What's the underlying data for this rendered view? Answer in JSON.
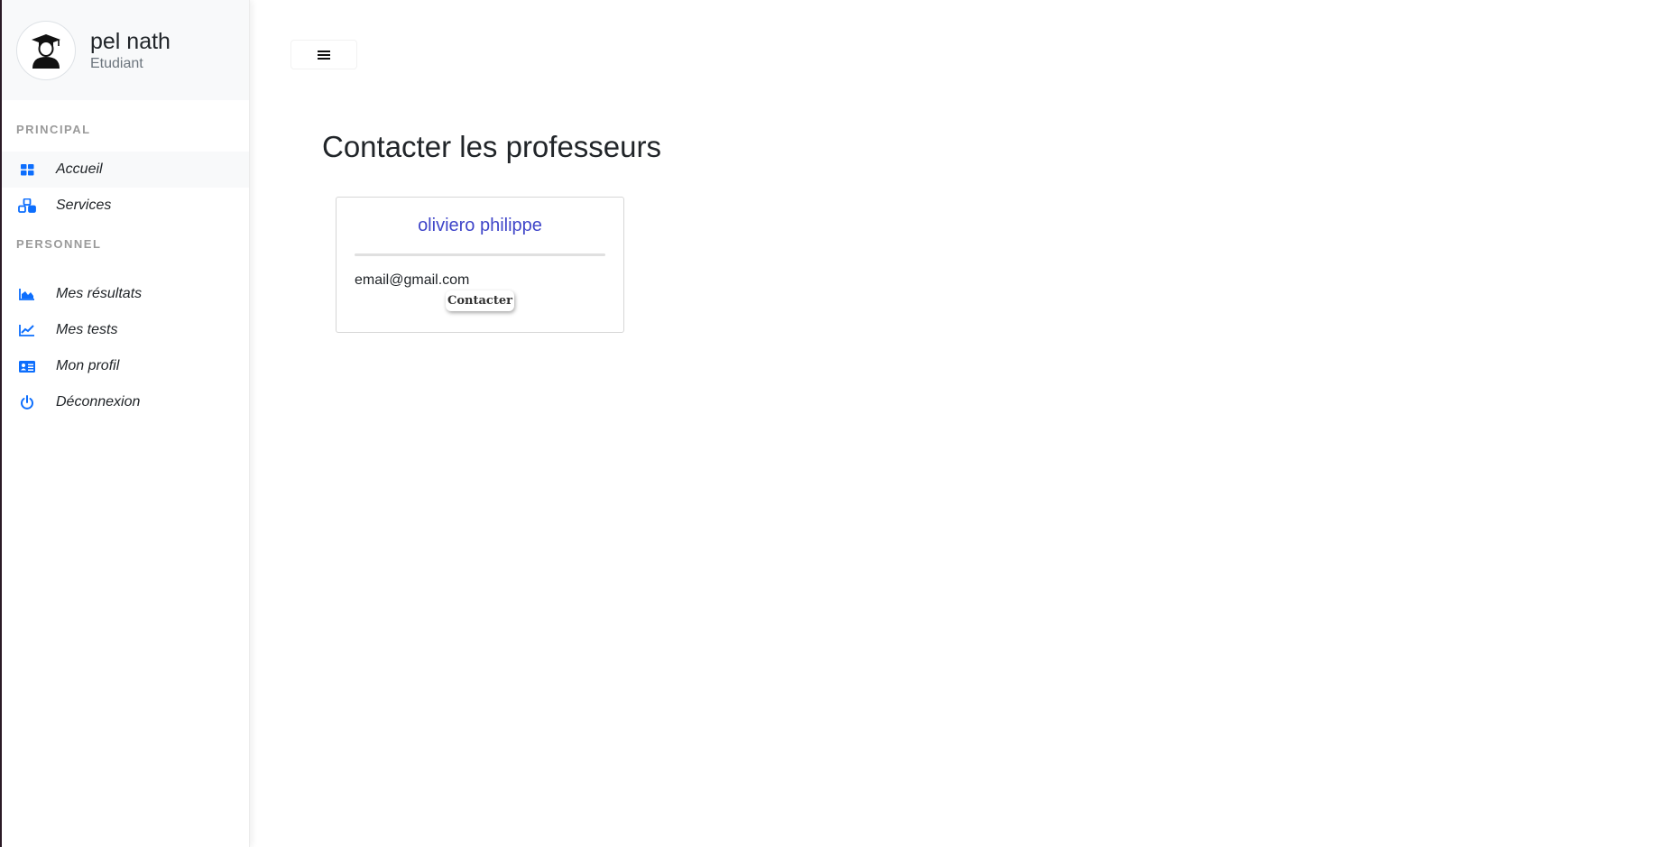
{
  "user": {
    "name": "pel nath",
    "role": "Etudiant"
  },
  "sidebar": {
    "sections": [
      {
        "title": "PRINCIPAL",
        "items": [
          {
            "label": "Accueil",
            "icon": "dashboard-grid-icon"
          },
          {
            "label": "Services",
            "icon": "cubes-icon"
          }
        ]
      },
      {
        "title": "PERSONNEL",
        "items": [
          {
            "label": "Mes résultats",
            "icon": "area-chart-icon"
          },
          {
            "label": "Mes tests",
            "icon": "line-chart-icon"
          },
          {
            "label": "Mon profil",
            "icon": "id-card-icon"
          },
          {
            "label": "Déconnexion",
            "icon": "power-icon"
          }
        ]
      }
    ],
    "active_item": "Accueil"
  },
  "header": {
    "menu_toggle_icon": "hamburger-menu-icon"
  },
  "main": {
    "title": "Contacter les professeurs",
    "professors": [
      {
        "name": "oliviero philippe",
        "email": "email@gmail.com",
        "button_label": "Contacter"
      }
    ]
  },
  "colors": {
    "accent": "#0d6efd",
    "professor_name": "#4046c9",
    "sidebar_header_bg": "#f8f9fa",
    "section_title": "#9a9a9a"
  }
}
